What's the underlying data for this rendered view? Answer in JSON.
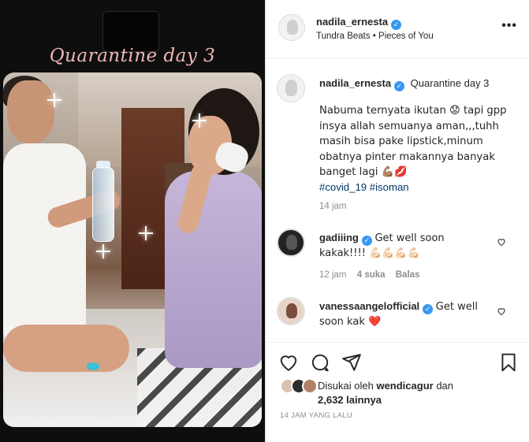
{
  "media": {
    "overlay_text": "Quarantine day 3"
  },
  "header": {
    "username": "nadila_ernesta",
    "music": "Tundra Beats • Pieces of You",
    "more": "•••"
  },
  "caption": {
    "username": "nadila_ernesta",
    "title": "Quarantine day 3",
    "body": "Nabuma ternyata ikutan 😟 tapi gpp insya allah semuanya aman,,,tuhh masih bisa pake lipstick,minum obatnya pinter makannya banyak banget lagi 💪🏽💋",
    "hashtags": "#covid_19 #isoman",
    "time": "14 jam"
  },
  "comments": [
    {
      "username": "gadiiing",
      "text": "Get well soon kakak!!!! 💪🏻💪🏻💪🏻💪🏻",
      "time": "12 jam",
      "likes": "4 suka",
      "reply": "Balas"
    },
    {
      "username": "vanessaangelofficial",
      "text": "Get well soon kak ❤️"
    }
  ],
  "likes": {
    "prefix": "Disukai oleh",
    "user": "wendicagur",
    "middle": "dan",
    "count": "2,632 lainnya"
  },
  "timestamp": "14 JAM YANG LALU",
  "icons": {
    "like": "heart-icon",
    "comment": "comment-icon",
    "share": "share-icon",
    "save": "bookmark-icon",
    "verified": "verified-badge-icon"
  },
  "colors": {
    "verified": "#3897f0",
    "hashtag": "#00376b",
    "muted": "#8e8e8e",
    "overlay_text": "#f2b6b6"
  }
}
